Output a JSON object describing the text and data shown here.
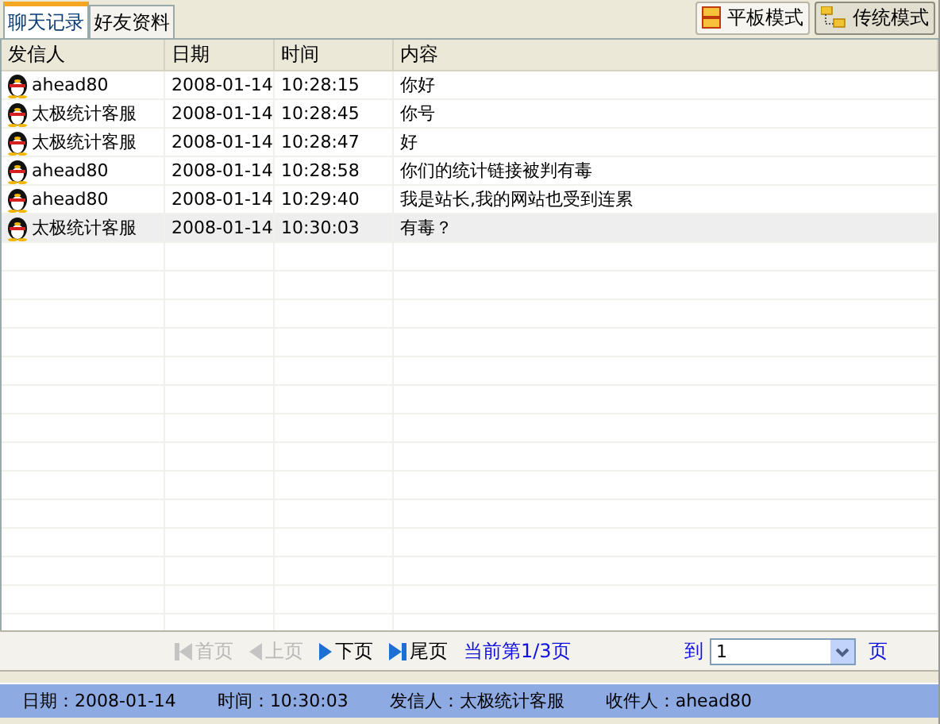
{
  "tabs": [
    {
      "label": "聊天记录",
      "selected": true
    },
    {
      "label": "好友资料",
      "selected": false
    }
  ],
  "mode_buttons": [
    {
      "label": "平板模式",
      "kind": "flat",
      "selected": false
    },
    {
      "label": "传统模式",
      "kind": "tree",
      "selected": true
    }
  ],
  "table": {
    "columns": [
      "发信人",
      "日期",
      "时间",
      "内容"
    ],
    "rows": [
      {
        "sender": "ahead80",
        "date": "2008-01-14",
        "time": "10:28:15",
        "content": "你好",
        "selected": false
      },
      {
        "sender": "太极统计客服",
        "date": "2008-01-14",
        "time": "10:28:45",
        "content": "你号",
        "selected": false
      },
      {
        "sender": "太极统计客服",
        "date": "2008-01-14",
        "time": "10:28:47",
        "content": "好",
        "selected": false
      },
      {
        "sender": "ahead80",
        "date": "2008-01-14",
        "time": "10:28:58",
        "content": "你们的统计链接被判有毒",
        "selected": false
      },
      {
        "sender": "ahead80",
        "date": "2008-01-14",
        "time": "10:29:40",
        "content": "我是站长,我的网站也受到连累",
        "selected": false
      },
      {
        "sender": "太极统计客服",
        "date": "2008-01-14",
        "time": "10:30:03",
        "content": "有毒？",
        "selected": true
      }
    ]
  },
  "pager": {
    "buttons": [
      {
        "label": "首页",
        "kind": "first",
        "disabled": true
      },
      {
        "label": "上页",
        "kind": "prev",
        "disabled": true
      },
      {
        "label": "下页",
        "kind": "next",
        "disabled": false
      },
      {
        "label": "尾页",
        "kind": "last",
        "disabled": false
      }
    ],
    "page_info": "当前第1/3页",
    "goto_label": "到",
    "page_value": "1",
    "page_suffix": "页"
  },
  "status_bar": [
    {
      "label": "日期：",
      "value": "2008-01-14"
    },
    {
      "label": "时间：",
      "value": "10:30:03"
    },
    {
      "label": "发信人：",
      "value": "太极统计客服"
    },
    {
      "label": "收件人：",
      "value": "ahead80"
    }
  ]
}
